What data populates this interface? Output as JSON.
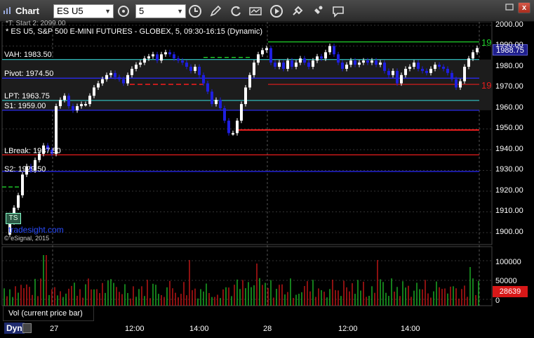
{
  "toolbar": {
    "app_title": "Chart",
    "symbol_value": "ES U5",
    "interval_value": "5",
    "close_label": "x",
    "icons": [
      "cursor-icon",
      "clock-icon",
      "pencil-icon",
      "refresh-icon",
      "study-icon",
      "play-icon",
      "drawing-tool-icon",
      "comment-icon"
    ]
  },
  "chart": {
    "trunc_header": "*T: Start 2: 2099.00",
    "symbol_description": "* ES U5, S&P 500 E-MINI FUTURES - GLOBEX, 5, 09:30-16:15 (Dynamic)",
    "levels": [
      {
        "label": "VAH: 1983.50"
      },
      {
        "label": "Pivot: 1974.50"
      },
      {
        "label": "LPT: 1963.75"
      },
      {
        "label": "S1: 1959.00"
      },
      {
        "label": "LBreak: 1937.50"
      },
      {
        "label": "S2: 1929.50"
      }
    ],
    "price_tag": "1988.75",
    "right_label_top": "19",
    "right_label_mid": "19",
    "watermark": "tradesight.com",
    "logo_text": "TS",
    "copyright": "© eSignal, 2015",
    "y_ticks": [
      "2000.00",
      "1990.00",
      "1980.00",
      "1970.00",
      "1960.00",
      "1950.00",
      "1940.00",
      "1930.00",
      "1920.00",
      "1910.00",
      "1900.00"
    ],
    "vol_ticks": [
      "100000",
      "50000",
      "0"
    ],
    "vol_label": "Vol (current price bar)",
    "vol_tag": "28639",
    "colors": {
      "up": "#ffffff",
      "down": "#1f1fe0",
      "resistance": "#e81c1c",
      "support": "#1fd12a",
      "pivot": "#2b2bff",
      "cyan": "#33cccc"
    }
  },
  "xaxis": {
    "dyn_label": "Dyn",
    "ticks": [
      "27",
      "12:00",
      "14:00",
      "28",
      "12:00",
      "14:00"
    ]
  }
}
